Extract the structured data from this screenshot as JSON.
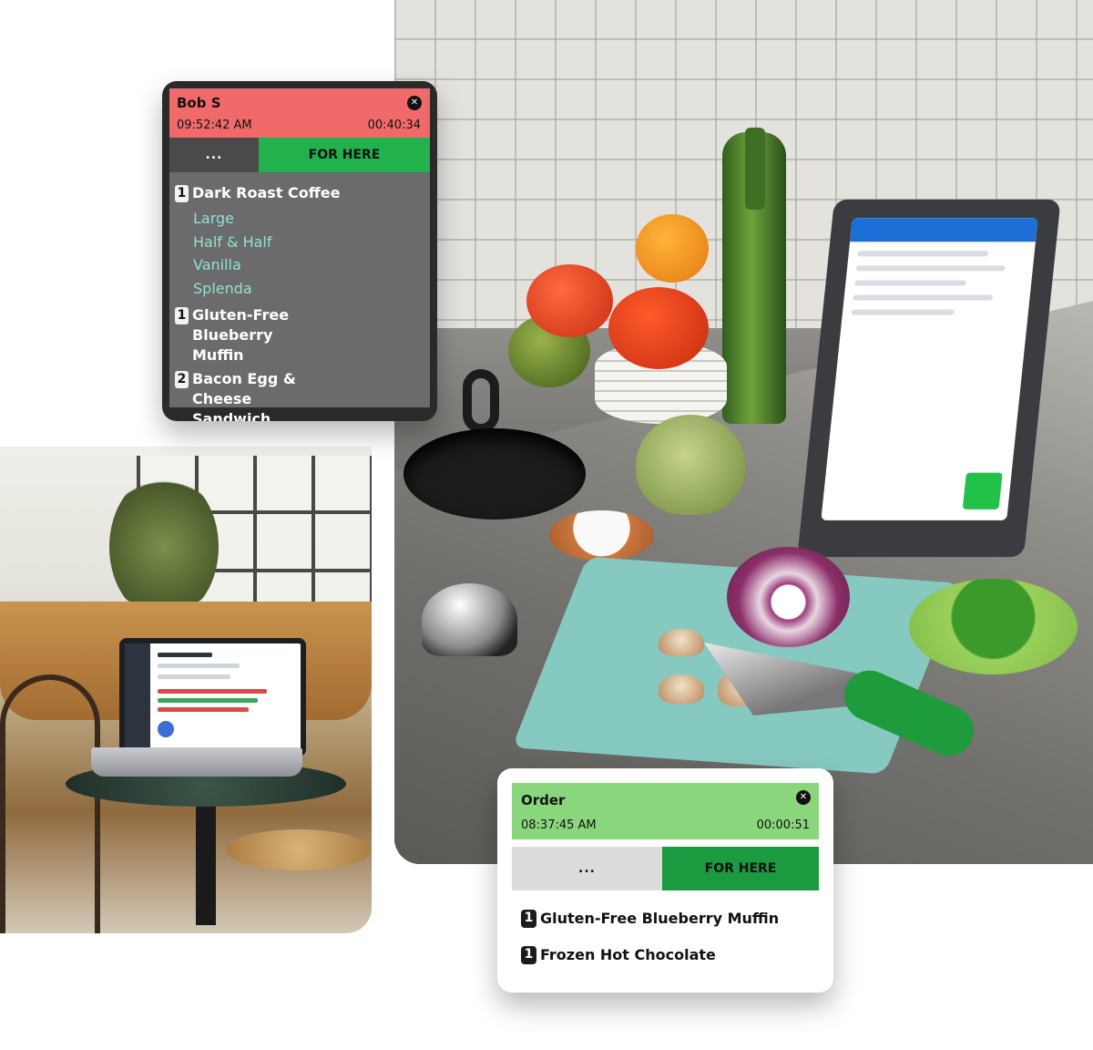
{
  "ticket_primary": {
    "customer": "Bob S",
    "time": "09:52:42 AM",
    "elapsed": "00:40:34",
    "more_label": "...",
    "order_type": "FOR HERE",
    "header_color": "#f16a6a",
    "items": [
      {
        "qty": "1",
        "name": "Dark Roast Coffee",
        "modifiers": [
          "Large",
          "Half & Half",
          "Vanilla",
          "Splenda"
        ]
      },
      {
        "qty": "1",
        "name": "Gluten-Free Blueberry Muffin",
        "modifiers": []
      },
      {
        "qty": "2",
        "name": "Bacon Egg & Cheese Sandwich",
        "modifiers": []
      }
    ]
  },
  "ticket_secondary": {
    "customer": "Order",
    "time": "08:37:45 AM",
    "elapsed": "00:00:51",
    "more_label": "...",
    "order_type": "FOR HERE",
    "header_color": "#8ad67c",
    "items": [
      {
        "qty": "1",
        "name": "Gluten-Free Blueberry Muffin"
      },
      {
        "qty": "1",
        "name": "Frozen Hot Chocolate"
      }
    ]
  },
  "colors": {
    "for_here_green": "#22b14c",
    "modifier_teal": "#8fe0d8"
  }
}
